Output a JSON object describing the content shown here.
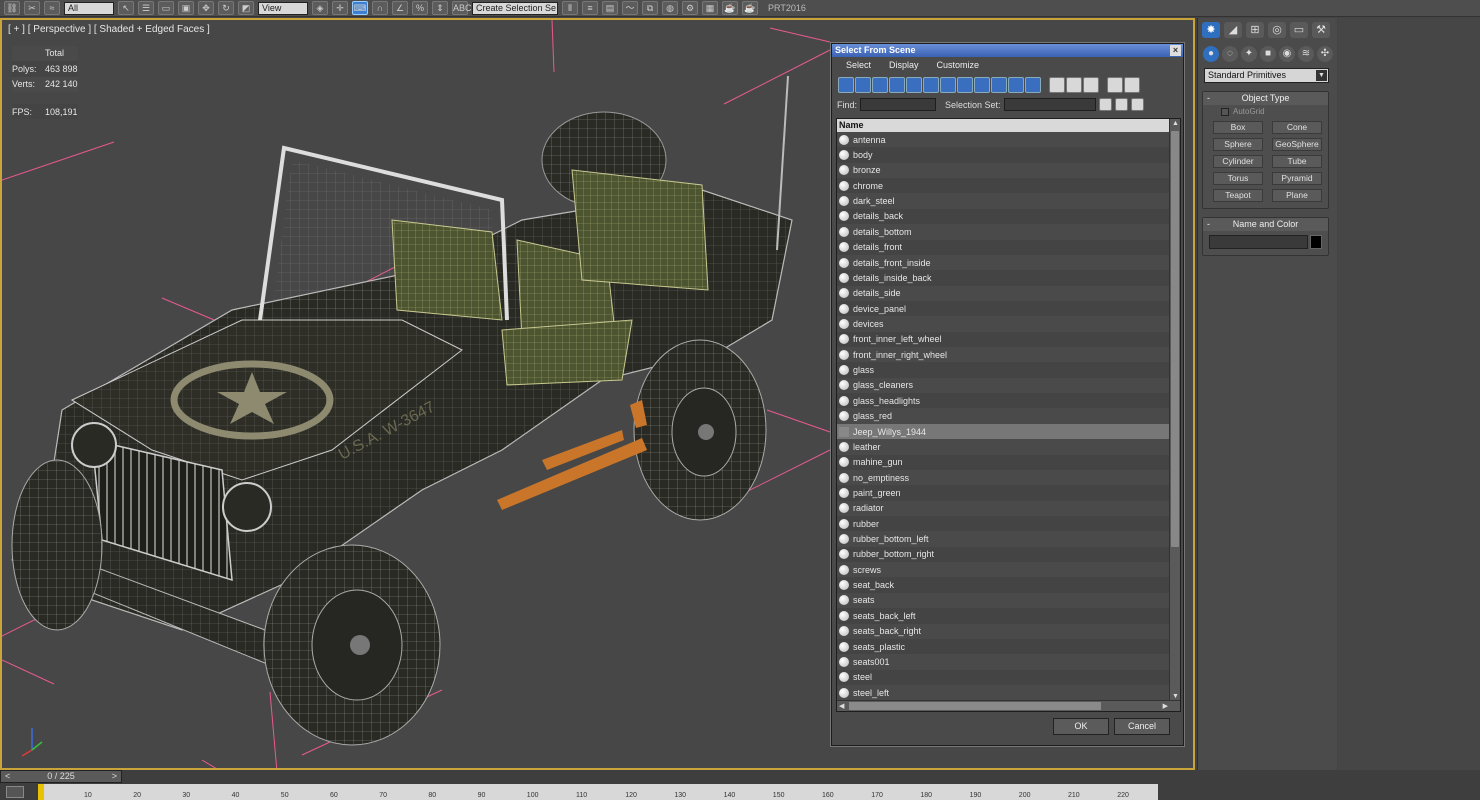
{
  "toolbar": {
    "select_filter": "All",
    "view_dropdown": "View",
    "selection_set_dropdown": "Create Selection Se",
    "workspace_label": "PRT2016"
  },
  "viewport": {
    "label": "[ + ] [ Perspective ] [ Shaded + Edged Faces ]",
    "stats": {
      "total_label": "Total",
      "polys_label": "Polys:",
      "polys_value": "463 898",
      "verts_label": "Verts:",
      "verts_value": "242 140",
      "fps_label": "FPS:",
      "fps_value": "108,191"
    },
    "decal_text": "U.S.A. W-3647"
  },
  "dialog": {
    "title": "Select From Scene",
    "menu": [
      "Select",
      "Display",
      "Customize"
    ],
    "find_label": "Find:",
    "selection_set_label": "Selection Set:",
    "column_name": "Name",
    "items": [
      "antenna",
      "body",
      "bronze",
      "chrome",
      "dark_steel",
      "details_back",
      "details_bottom",
      "details_front",
      "details_front_inside",
      "details_inside_back",
      "details_side",
      "device_panel",
      "devices",
      "front_inner_left_wheel",
      "front_inner_right_wheel",
      "glass",
      "glass_cleaners",
      "glass_headlights",
      "glass_red",
      "Jeep_Willys_1944",
      "leather",
      "mahine_gun",
      "no_emptiness",
      "paint_green",
      "radiator",
      "rubber",
      "rubber_bottom_left",
      "rubber_bottom_right",
      "screws",
      "seat_back",
      "seats",
      "seats_back_left",
      "seats_back_right",
      "seats_plastic",
      "seats001",
      "steel",
      "steel_left"
    ],
    "selected_item": "Jeep_Willys_1944",
    "ok_label": "OK",
    "cancel_label": "Cancel"
  },
  "command_panel": {
    "category": "Standard Primitives",
    "object_type_title": "Object Type",
    "autogrid_label": "AutoGrid",
    "buttons": [
      "Box",
      "Cone",
      "Sphere",
      "GeoSphere",
      "Cylinder",
      "Tube",
      "Torus",
      "Pyramid",
      "Teapot",
      "Plane"
    ],
    "name_and_color_title": "Name and Color",
    "object_color": "#000000"
  },
  "timeline": {
    "frame_display": "0 / 225",
    "ticks": [
      "10",
      "20",
      "30",
      "40",
      "50",
      "60",
      "70",
      "80",
      "90",
      "100",
      "110",
      "120",
      "130",
      "140",
      "150",
      "160",
      "170",
      "180",
      "190",
      "200",
      "210",
      "220"
    ]
  },
  "colors": {
    "viewport_border": "#c9a43a",
    "stats_text": "#e8d94a",
    "selection_blue": "#3a62b3",
    "bounding_lines": "#e85a8f"
  }
}
